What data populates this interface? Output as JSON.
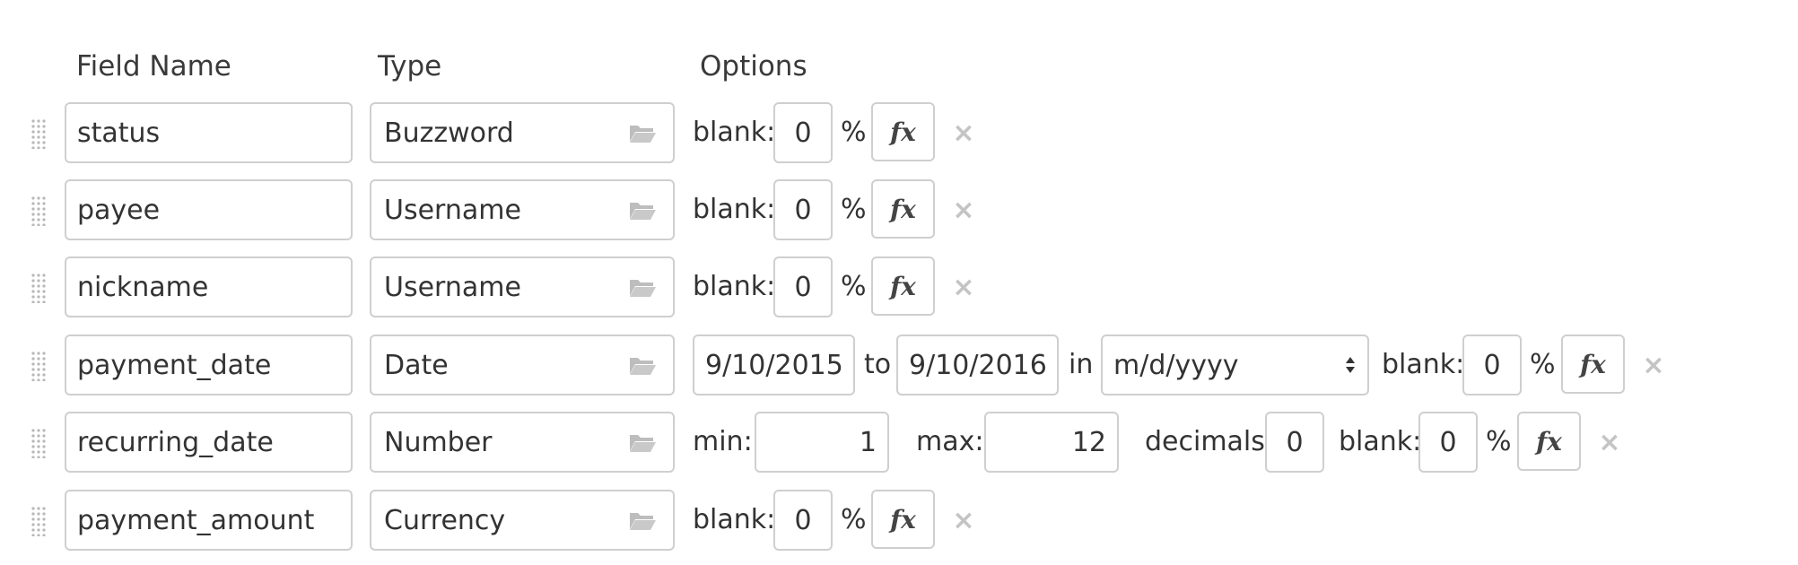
{
  "headers": {
    "field_name": "Field Name",
    "type": "Type",
    "options": "Options"
  },
  "rows": [
    {
      "name": "status",
      "type": "Buzzword",
      "blank_label": "blank:",
      "blank_value": "0",
      "percent": "%",
      "fx": "fx",
      "remove": "×"
    },
    {
      "name": "payee",
      "type": "Username",
      "blank_label": "blank:",
      "blank_value": "0",
      "percent": "%",
      "fx": "fx",
      "remove": "×"
    },
    {
      "name": "nickname",
      "type": "Username",
      "blank_label": "blank:",
      "blank_value": "0",
      "percent": "%",
      "fx": "fx",
      "remove": "×"
    },
    {
      "name": "payment_date",
      "type": "Date",
      "from_date": "9/10/2015",
      "to_label": "to",
      "to_date": "9/10/2016",
      "in_label": "in",
      "format": "m/d/yyyy",
      "blank_label": "blank:",
      "blank_value": "0",
      "percent": "%",
      "fx": "fx",
      "remove": "×"
    },
    {
      "name": "recurring_date",
      "type": "Number",
      "min_label": "min:",
      "min_value": "1",
      "max_label": "max:",
      "max_value": "12",
      "decimals_label": "decimals:",
      "decimals_value": "0",
      "blank_label": "blank:",
      "blank_value": "0",
      "percent": "%",
      "fx": "fx",
      "remove": "×"
    },
    {
      "name": "payment_amount",
      "type": "Currency",
      "blank_label": "blank:",
      "blank_value": "0",
      "percent": "%",
      "fx": "fx",
      "remove": "×"
    }
  ],
  "icons": {
    "drag": "drag-handle-icon",
    "folder": "folder-open-icon",
    "remove": "close-icon",
    "select": "chevron-updown-icon"
  },
  "colors": {
    "border": "#cfcfcf",
    "text": "#333333",
    "muted_icon": "#c4c4c4"
  }
}
